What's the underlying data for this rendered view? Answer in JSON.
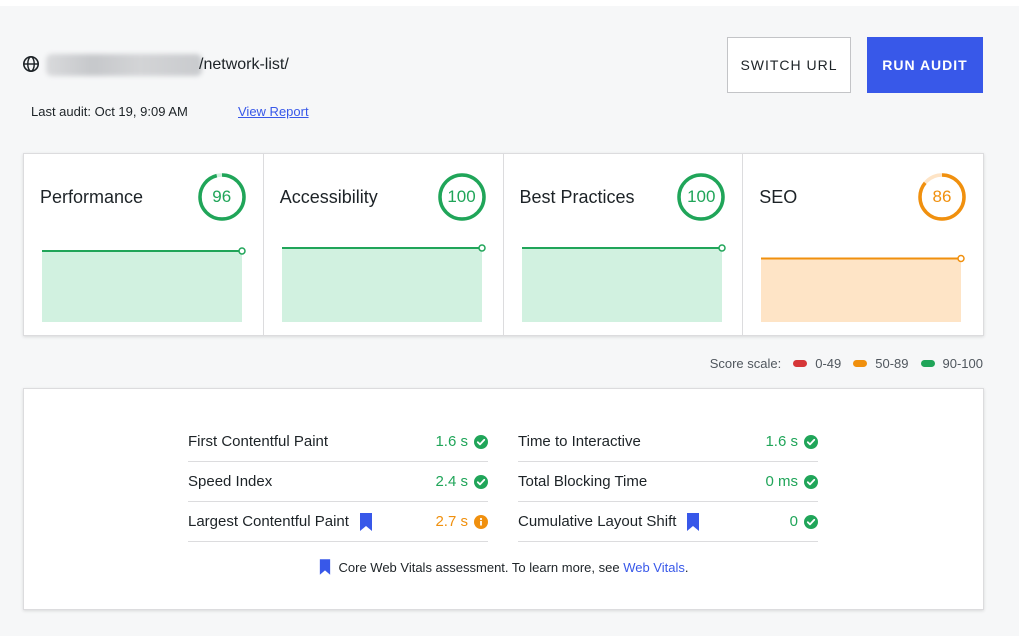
{
  "header": {
    "url_suffix": "/network-list/",
    "last_audit": "Last audit: Oct 19, 9:09 AM",
    "view_report": "View Report",
    "switch_url": "SWITCH URL",
    "run_audit": "RUN AUDIT"
  },
  "scores": [
    {
      "title": "Performance",
      "score": "96",
      "value": 96,
      "status": "good"
    },
    {
      "title": "Accessibility",
      "score": "100",
      "value": 100,
      "status": "good"
    },
    {
      "title": "Best Practices",
      "score": "100",
      "value": 100,
      "status": "good"
    },
    {
      "title": "SEO",
      "score": "86",
      "value": 86,
      "status": "average"
    }
  ],
  "score_scale": {
    "label": "Score scale:",
    "ranges": [
      {
        "label": "0-49",
        "color": "#d63638"
      },
      {
        "label": "50-89",
        "color": "#f0900e"
      },
      {
        "label": "90-100",
        "color": "#20a559"
      }
    ]
  },
  "colors": {
    "good": "#20a559",
    "good_fill": "#d1f1e0",
    "average": "#f0900e",
    "average_fill": "#fee4c6",
    "accent": "#3858e9"
  },
  "metrics": {
    "left": [
      {
        "label": "First Contentful Paint",
        "value": "1.6 s",
        "status": "good",
        "core_web_vital": false
      },
      {
        "label": "Speed Index",
        "value": "2.4 s",
        "status": "good",
        "core_web_vital": false
      },
      {
        "label": "Largest Contentful Paint",
        "value": "2.7 s",
        "status": "average",
        "core_web_vital": true
      }
    ],
    "right": [
      {
        "label": "Time to Interactive",
        "value": "1.6 s",
        "status": "good",
        "core_web_vital": false
      },
      {
        "label": "Total Blocking Time",
        "value": "0 ms",
        "status": "good",
        "core_web_vital": false
      },
      {
        "label": "Cumulative Layout Shift",
        "value": "0",
        "status": "good",
        "core_web_vital": true
      }
    ]
  },
  "footnote": {
    "text": "Core Web Vitals assessment. To learn more, see",
    "link": "Web Vitals",
    "end": "."
  },
  "icons": {
    "site": "globe-icon",
    "good": "check-circle-icon",
    "average": "info-circle-icon",
    "core_web_vital": "bookmark-icon"
  }
}
